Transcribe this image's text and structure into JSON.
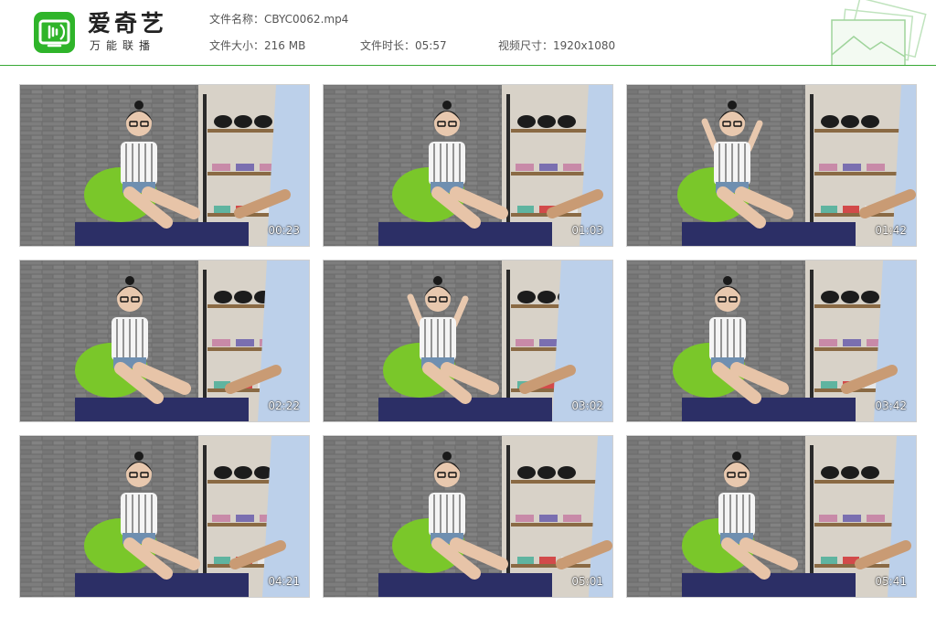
{
  "brand": {
    "name": "爱奇艺",
    "subtitle": "万能联播",
    "logo_icon": "iqiyi-tv-logo",
    "accent_color": "#2fb42a"
  },
  "file_info": {
    "name_label": "文件名称：",
    "name_value": "CBYC0062.mp4",
    "size_label": "文件大小：",
    "size_value": "216 MB",
    "duration_label": "文件时长：",
    "duration_value": "05:57",
    "dimensions_label": "视频尺寸：",
    "dimensions_value": "1920x1080"
  },
  "thumbnails": [
    {
      "timestamp": "00:23"
    },
    {
      "timestamp": "01:03"
    },
    {
      "timestamp": "01:42"
    },
    {
      "timestamp": "02:22"
    },
    {
      "timestamp": "03:02"
    },
    {
      "timestamp": "03:42"
    },
    {
      "timestamp": "04:21"
    },
    {
      "timestamp": "05:01"
    },
    {
      "timestamp": "05:41"
    }
  ]
}
